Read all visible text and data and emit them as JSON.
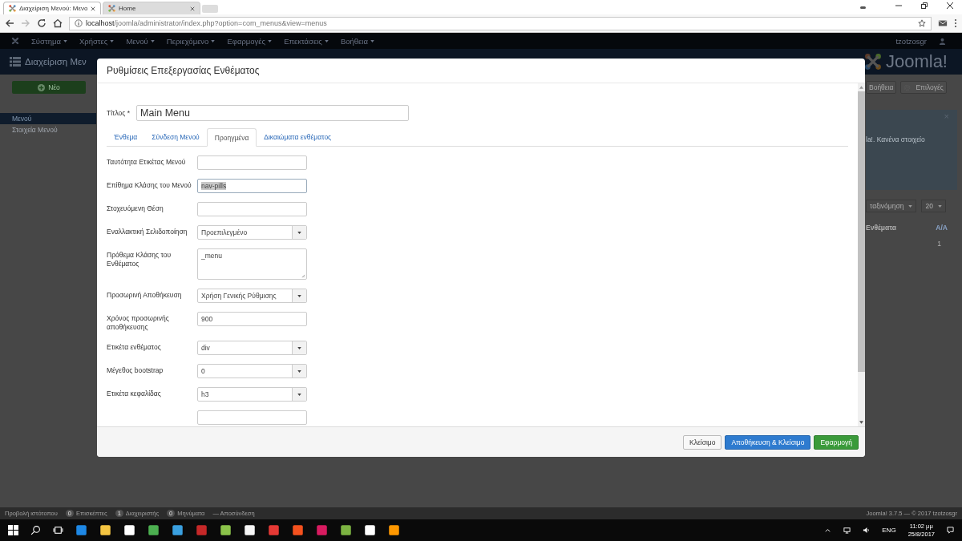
{
  "browser": {
    "tabs": [
      {
        "title": "Διαχείριση Μενού: Μενο",
        "selected": true
      },
      {
        "title": "Home",
        "selected": false
      }
    ],
    "url_host": "localhost",
    "url_path": "/joomla/administrator/index.php?option=com_menus&view=menus"
  },
  "nav": {
    "items": [
      "Σύστημα",
      "Χρήστες",
      "Μενού",
      "Περιεχόμενο",
      "Εφαρμογές",
      "Επεκτάσεις",
      "Βοήθεια"
    ],
    "user": "tzotzosgr"
  },
  "header": {
    "title": "Διαχείριση Μεν",
    "logo": "Joomla!"
  },
  "toolbar": {
    "new_button": "Νέο",
    "help_button": "Βοήθεια",
    "options_button": "Επιλογές"
  },
  "sidebar": {
    "items": [
      {
        "label": "Μενού",
        "selected": true
      },
      {
        "label": "Στοιχεία Μενού",
        "selected": false
      }
    ]
  },
  "right_panel": {
    "alert_text": "la!. Κανένα στοιχείο",
    "alert_close": "×",
    "sort_select": "ταξινόμηση",
    "limit_select": "20",
    "columns": [
      "Ενθέματα",
      "Α/Α"
    ],
    "rows": [
      {
        "order": "1"
      }
    ]
  },
  "modal": {
    "title": "Ρυθμίσεις Επεξεργασίας Ενθέματος",
    "title_label": "Τίτλος *",
    "title_value": "Main Menu",
    "tabs": [
      {
        "label": "Ένθεμα",
        "selected": false
      },
      {
        "label": "Σύνδεση Μενού",
        "selected": false
      },
      {
        "label": "Προηγμένα",
        "selected": true
      },
      {
        "label": "Δικαιώματα ενθέματος",
        "selected": false
      }
    ],
    "fields": [
      {
        "label": "Ταυτότητα Ετικέτας Μενού",
        "kind": "text",
        "highlighted": false
      },
      {
        "label": "Επίθημα Κλάσης του Μενού",
        "kind": "text",
        "value": "nav-pills",
        "highlighted": true
      },
      {
        "label": "Στοχευόμενη Θέση",
        "kind": "text",
        "highlighted": false
      },
      {
        "label": "Εναλλακτική Σελιδοποίηση",
        "kind": "select",
        "value": "Προεπιλεγμένο",
        "highlighted": false
      },
      {
        "label": "Πρόθεμα Κλάσης του Ενθέματος",
        "kind": "textarea",
        "value": "_menu",
        "highlighted": false
      },
      {
        "label": "Προσωρινή Αποθήκευση",
        "kind": "select",
        "value": "Χρήση Γενικής Ρύθμισης",
        "highlighted": false
      },
      {
        "label": "Χρόνος προσωρινής αποθήκευσης",
        "kind": "text",
        "value": "900",
        "highlighted": false
      },
      {
        "label": "Ετικέτα ενθέματος",
        "kind": "select",
        "value": "div",
        "highlighted": false
      },
      {
        "label": "Μέγεθος bootstrap",
        "kind": "select",
        "value": "0",
        "highlighted": false
      },
      {
        "label": "Ετικέτα κεφαλίδας",
        "kind": "select",
        "value": "h3",
        "highlighted": false
      }
    ],
    "buttons": [
      {
        "label": "Κλείσιμο",
        "kind": "default"
      },
      {
        "label": "Αποθήκευση & Κλείσιμο",
        "kind": "primary"
      },
      {
        "label": "Εφαρμογή",
        "kind": "success"
      }
    ]
  },
  "status_bar": {
    "items": [
      {
        "label": "Προβολή ιστότοπου"
      },
      {
        "count": "0",
        "label": "Επισκέπτες"
      },
      {
        "count": "1",
        "label": "Διαχειριστής"
      },
      {
        "count": "0",
        "label": "Μηνύματα"
      },
      {
        "label": "— Αποσύνδεση"
      }
    ],
    "copyright": "Joomla! 3.7.5 — © 2017 tzotzosgr"
  },
  "taskbar": {
    "language": "ENG",
    "time": "11:02 μμ",
    "date": "25/8/2017"
  }
}
